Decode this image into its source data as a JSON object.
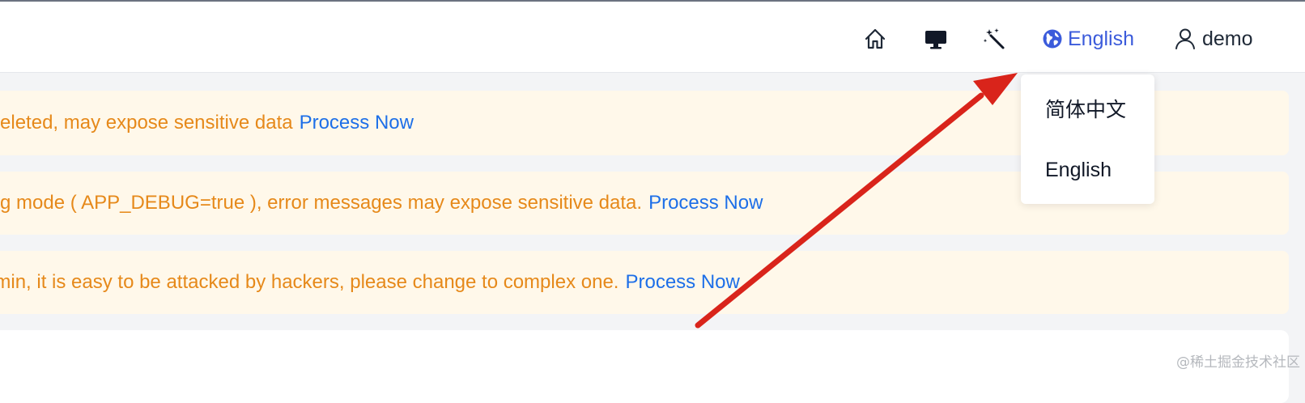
{
  "header": {
    "icons": {
      "home": "home-icon",
      "display": "monitor-icon",
      "wand": "magic-wand-icon",
      "language": "globe-icon",
      "user": "user-icon"
    },
    "language_label": "English",
    "user_label": "demo"
  },
  "language_menu": {
    "options": [
      "简体中文",
      "English"
    ]
  },
  "notices": [
    {
      "message": "ot deleted, may expose sensitive data",
      "action": "Process Now"
    },
    {
      "message": "ebug mode ( APP_DEBUG=true ), error messages may expose sensitive data.",
      "action": "Process Now"
    },
    {
      "message": "/admin, it is easy to be attacked by hackers, please change to complex one.",
      "action": "Process Now"
    }
  ],
  "watermark": "@稀土掘金技术社区",
  "colors": {
    "accent": "#3b5bdb",
    "link": "#1d6fe8",
    "warning_text": "#e6891a",
    "warning_bg": "#fff8ea",
    "annotation_arrow": "#d9241b"
  }
}
